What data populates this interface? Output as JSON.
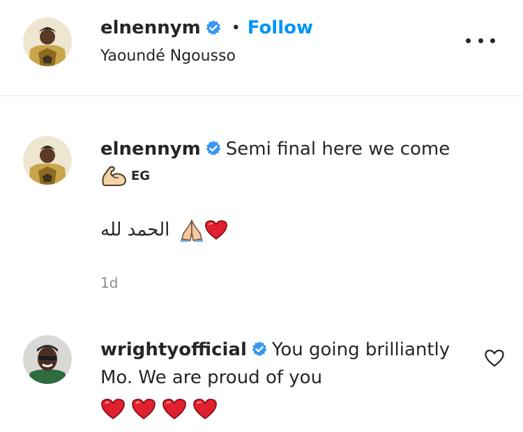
{
  "post_header": {
    "username": "elnennym",
    "separator": "•",
    "follow_label": "Follow",
    "location": "Yaoundé Ngousso",
    "more_icon": "more-horizontal-icon"
  },
  "caption": {
    "username": "elnennym",
    "text": "Semi final here we come",
    "flex_emoji": "flexed-biceps-icon",
    "suffix": "EG",
    "arabic_text": "الحمد لله",
    "emojis": [
      "folded-hands-icon",
      "red-heart-icon"
    ],
    "timestamp": "1d"
  },
  "comment": {
    "username": "wrightyofficial",
    "text": "You going brilliantly Mo. We are proud of you",
    "hearts": [
      "red-heart-icon",
      "red-heart-icon",
      "red-heart-icon",
      "red-heart-icon"
    ],
    "like_icon": "heart-outline-icon"
  },
  "colors": {
    "text": "#262626",
    "link_blue": "#0095f6",
    "verified_blue": "#3897f0",
    "muted": "#8e8e8e",
    "heart_red": "#e0202e"
  }
}
